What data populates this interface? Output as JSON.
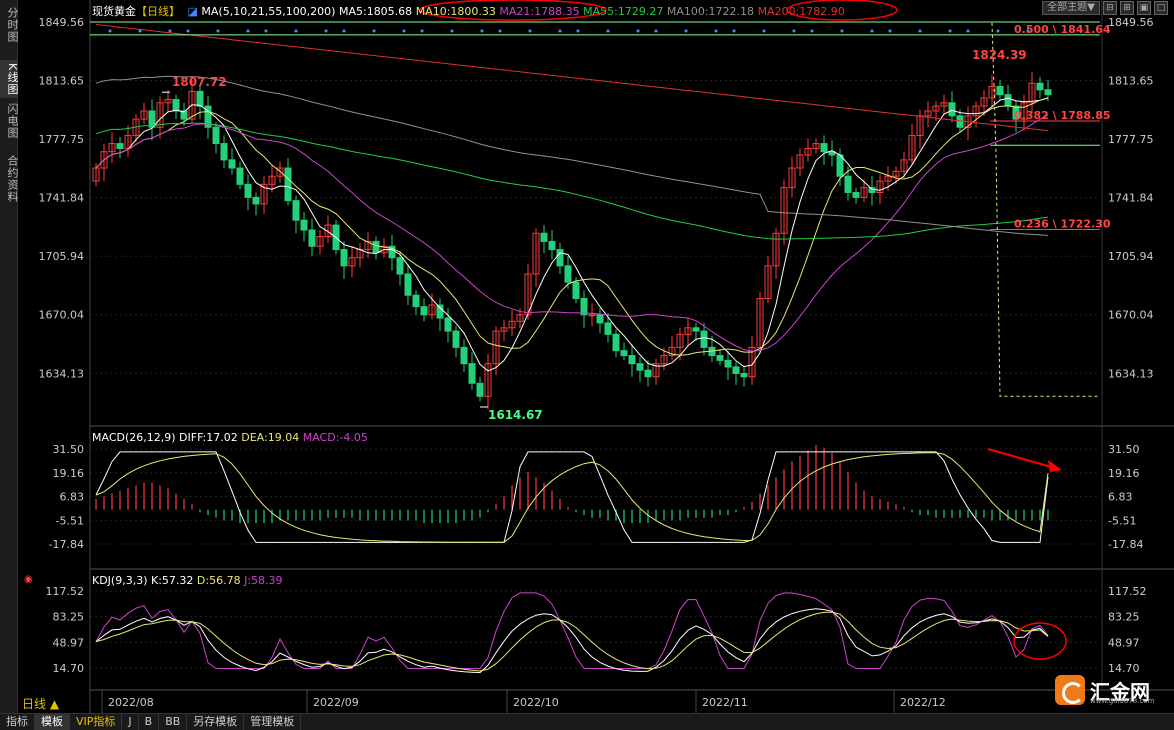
{
  "sidebar": {
    "tabs": [
      {
        "label": "分时图",
        "active": false
      },
      {
        "label": "K线图",
        "active": true
      },
      {
        "label": "闪电图",
        "active": false
      },
      {
        "label": "合约资料",
        "active": false
      }
    ]
  },
  "header": {
    "symbol": "现货黄金",
    "period": "【日线】",
    "ma_params": "MA(5,10,21,55,100,200)",
    "ma5": "MA5:1805.68",
    "ma10": "MA10:1800.33",
    "ma21": "MA21:1788.35",
    "ma55": "MA55:1729.27",
    "ma100": "MA100:1722.18",
    "ma200": "MA200:1782.90",
    "theme_button": "全部主题▼"
  },
  "macd_header": {
    "params": "MACD(26,12,9)",
    "diff": "DIFF:17.02",
    "dea": "DEA:19.04",
    "macd": "MACD:-4.05"
  },
  "kdj_header": {
    "params": "KDJ(9,3,3)",
    "k": "K:57.32",
    "d": "D:56.78",
    "j": "J:58.39"
  },
  "price_axis": [
    "1849.56",
    "1813.65",
    "1777.75",
    "1741.84",
    "1705.94",
    "1670.04",
    "1634.13"
  ],
  "macd_axis": [
    "31.50",
    "19.16",
    "6.83",
    "-5.51",
    "-17.84"
  ],
  "kdj_axis": [
    "117.52",
    "83.25",
    "48.97",
    "14.70"
  ],
  "time_axis": [
    "2022/08",
    "2022/09",
    "2022/10",
    "2022/11",
    "2022/12"
  ],
  "annotations": {
    "high_aug": "1807.72",
    "low_sep": "1614.67",
    "high_dec": "1824.39",
    "fib_0500": "0.500 \\ 1841.64",
    "fib_0382": "0.382 \\ 1788.85",
    "fib_0236": "0.236 \\ 1722.30"
  },
  "bottom": {
    "period_button": "日线 ▲",
    "tabs": [
      "指标",
      "模板",
      "VIP指标",
      "J",
      "B",
      "BB",
      "另存模板",
      "管理模板"
    ],
    "active_tab": "模板"
  },
  "logo": {
    "text": "汇金网",
    "url": "www.gold678.com"
  },
  "colors": {
    "up": "#ff3b3b",
    "down": "#22d17a",
    "ma5": "#ffffff",
    "ma10": "#e8e870",
    "ma21": "#cc44cc",
    "ma55": "#22cc44",
    "ma100": "#909090",
    "ma200": "#e03030",
    "label_red": "#ff4444",
    "label_green": "#44ff88",
    "circle": "#ff0000"
  },
  "chart_data": [
    {
      "type": "candlestick",
      "title": "现货黄金【日线】",
      "ylim": [
        1614.67,
        1849.56
      ],
      "categories": [
        "2022/08",
        "2022/09",
        "2022/10",
        "2022/11",
        "2022/12"
      ],
      "series": [
        {
          "name": "现货黄金",
          "closes": [
            1760,
            1770,
            1775,
            1772,
            1780,
            1790,
            1795,
            1785,
            1800,
            1802,
            1795,
            1790,
            1807,
            1798,
            1785,
            1775,
            1765,
            1760,
            1750,
            1742,
            1738,
            1750,
            1755,
            1760,
            1740,
            1728,
            1722,
            1712,
            1718,
            1725,
            1710,
            1700,
            1705,
            1710,
            1715,
            1708,
            1712,
            1705,
            1695,
            1682,
            1675,
            1670,
            1676,
            1668,
            1660,
            1650,
            1640,
            1628,
            1620,
            1640,
            1660,
            1662,
            1666,
            1670,
            1695,
            1720,
            1715,
            1710,
            1700,
            1690,
            1680,
            1670,
            1670,
            1665,
            1658,
            1648,
            1645,
            1640,
            1636,
            1632,
            1640,
            1645,
            1650,
            1658,
            1662,
            1660,
            1650,
            1645,
            1642,
            1638,
            1634,
            1632,
            1650,
            1680,
            1700,
            1720,
            1748,
            1760,
            1768,
            1772,
            1775,
            1770,
            1768,
            1755,
            1745,
            1742,
            1748,
            1745,
            1752,
            1755,
            1758,
            1765,
            1780,
            1792,
            1795,
            1798,
            1800,
            1792,
            1785,
            1792,
            1798,
            1803,
            1810,
            1805,
            1798,
            1790,
            1800,
            1812,
            1808,
            1805
          ],
          "opens": [
            1752,
            1760,
            1770,
            1775,
            1772,
            1780,
            1790,
            1795,
            1785,
            1800,
            1802,
            1795,
            1790,
            1807,
            1798,
            1785,
            1775,
            1765,
            1760,
            1750,
            1742,
            1738,
            1750,
            1755,
            1760,
            1740,
            1728,
            1722,
            1712,
            1718,
            1725,
            1710,
            1700,
            1705,
            1710,
            1715,
            1708,
            1712,
            1705,
            1695,
            1682,
            1675,
            1670,
            1676,
            1668,
            1660,
            1650,
            1640,
            1628,
            1620,
            1640,
            1660,
            1662,
            1666,
            1670,
            1695,
            1720,
            1715,
            1710,
            1700,
            1690,
            1680,
            1670,
            1670,
            1665,
            1658,
            1648,
            1645,
            1640,
            1636,
            1632,
            1640,
            1645,
            1650,
            1658,
            1662,
            1660,
            1650,
            1645,
            1642,
            1638,
            1634,
            1632,
            1650,
            1680,
            1700,
            1720,
            1748,
            1760,
            1768,
            1772,
            1775,
            1770,
            1768,
            1755,
            1745,
            1742,
            1748,
            1745,
            1752,
            1755,
            1758,
            1765,
            1780,
            1792,
            1795,
            1798,
            1800,
            1792,
            1785,
            1792,
            1798,
            1803,
            1810,
            1805,
            1798,
            1790,
            1800,
            1812,
            1808
          ]
        }
      ]
    },
    {
      "type": "bar",
      "title": "MACD(26,12,9)",
      "ylim": [
        -17.84,
        31.5
      ],
      "series": [
        {
          "name": "MACD",
          "values": [
            4,
            5,
            6,
            7,
            8,
            9,
            10,
            10,
            9,
            8,
            6,
            4,
            2,
            -1,
            -2,
            -3,
            -4,
            -4,
            -5,
            -5,
            -5,
            -5,
            -5,
            -4,
            -4,
            -4,
            -4,
            -4,
            -4,
            -3,
            -3,
            -3,
            -3,
            -4,
            -4,
            -4,
            -4,
            -4,
            -4,
            -4,
            -4,
            -5,
            -5,
            -5,
            -5,
            -5,
            -4,
            -4,
            -3,
            -1,
            2,
            5,
            9,
            12,
            14,
            12,
            10,
            7,
            4,
            1,
            -1,
            -2,
            -3,
            -3,
            -4,
            -4,
            -5,
            -5,
            -5,
            -5,
            -4,
            -4,
            -4,
            -4,
            -3,
            -3,
            -3,
            -3,
            -2,
            -2,
            -1,
            1,
            3,
            6,
            9,
            12,
            15,
            18,
            20,
            22,
            24,
            23,
            21,
            18,
            14,
            10,
            7,
            5,
            4,
            3,
            2,
            1,
            -1,
            -2,
            -2,
            -3,
            -3,
            -3,
            -3,
            -3,
            -3,
            -3,
            -4,
            -4,
            -4,
            -4,
            -4,
            -4,
            -4,
            -4
          ]
        },
        {
          "name": "DIFF",
          "values": [
            17.02
          ]
        },
        {
          "name": "DEA",
          "values": [
            19.04
          ]
        }
      ]
    },
    {
      "type": "line",
      "title": "KDJ(9,3,3)",
      "ylim": [
        14.7,
        117.52
      ],
      "series": [
        {
          "name": "K",
          "values": [
            57.32
          ]
        },
        {
          "name": "D",
          "values": [
            56.78
          ]
        },
        {
          "name": "J",
          "values": [
            58.39
          ]
        }
      ]
    }
  ]
}
